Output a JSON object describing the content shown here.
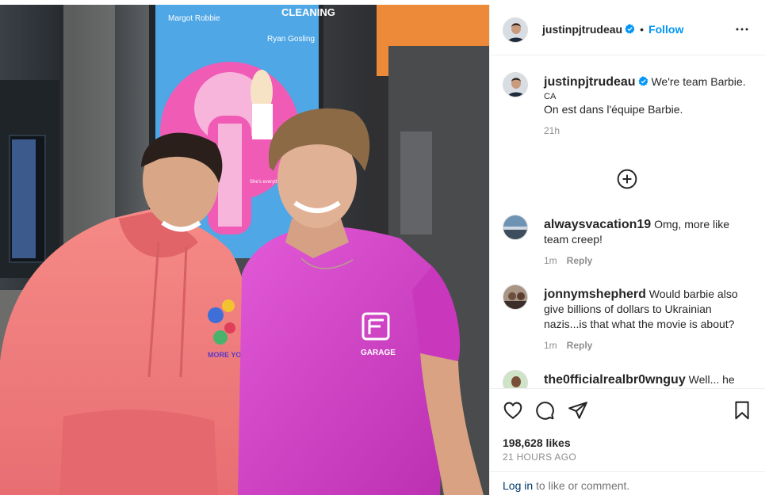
{
  "post": {
    "author": "justinpjtrudeau",
    "follow_label": "Follow",
    "separator": "•",
    "caption_line1": "We're team Barbie.",
    "caption_lang": "CA",
    "caption_line2": "On est dans l'équipe Barbie.",
    "caption_age": "21h",
    "likes": "198,628 likes",
    "posted": "21 HOURS AGO",
    "login_link": "Log in",
    "login_rest": " to like or comment."
  },
  "poster": {
    "top_text": "CLEANING",
    "name_left": "Margot Robbie",
    "name_right": "Ryan Gosling",
    "tagline": "She's everything. He's just Ken."
  },
  "shirt_text": "GARAGE",
  "hoodie_text": "MORE YOU",
  "comments": [
    {
      "user": "alwaysvacation19",
      "text": "Omg, more like team creep!",
      "age": "1m",
      "reply": "Reply"
    },
    {
      "user": "jonnymshepherd",
      "text": "Would barbie also give billions of dollars to Ukrainian nazis...is that what the movie is about?",
      "age": "1m",
      "reply": "Reply"
    },
    {
      "user": "the0fficialrealbr0wnguy",
      "text": "Well... he",
      "age": "",
      "reply": ""
    }
  ],
  "icons": {
    "verified": "verified-badge-icon",
    "more": "more-options-icon",
    "load_more": "load-more-comments-icon",
    "like": "heart-icon",
    "comment": "comment-bubble-icon",
    "share": "paper-plane-icon",
    "save": "bookmark-icon"
  },
  "colors": {
    "accent": "#0095f6",
    "verified": "#0095f6",
    "link": "#00376b",
    "muted": "#8e8e8e",
    "hoodie": "#f07a7c",
    "shirt": "#d63fc8",
    "poster_pink": "#f05bb6"
  }
}
